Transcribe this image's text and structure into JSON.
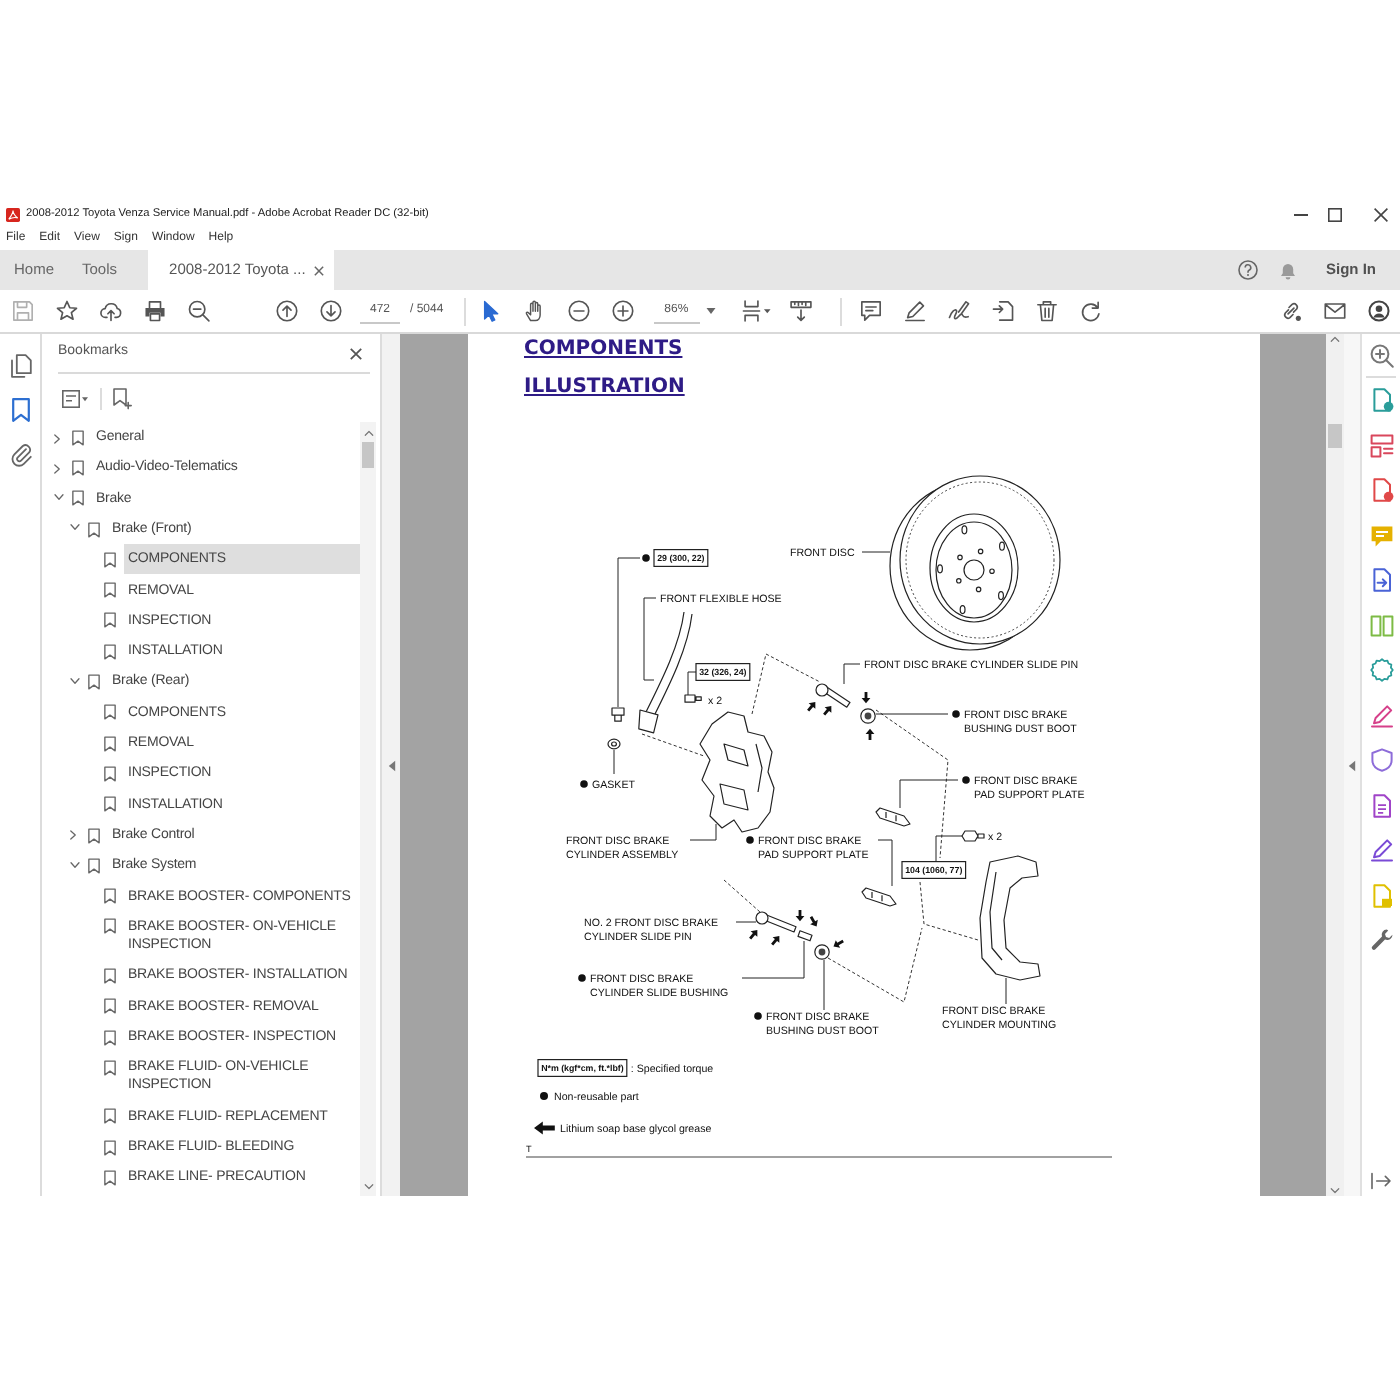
{
  "window": {
    "title": "2008-2012 Toyota Venza Service Manual.pdf - Adobe Acrobat Reader DC (32-bit)"
  },
  "menu": [
    "File",
    "Edit",
    "View",
    "Sign",
    "Window",
    "Help"
  ],
  "tabs": [
    {
      "label": "Home",
      "selected": false,
      "closable": false
    },
    {
      "label": "Tools",
      "selected": false,
      "closable": false
    },
    {
      "label": "2008-2012 Toyota ...",
      "selected": true,
      "closable": true
    }
  ],
  "account": {
    "sign_in": "Sign In"
  },
  "toolbar": {
    "page": "472",
    "page_count": "/ 5044",
    "pointer_tools": [
      {
        "kind": "select",
        "selected": true
      },
      {
        "kind": "hand",
        "selected": false
      }
    ],
    "zoom": "86%"
  },
  "side_panels": [
    {
      "kind": "pages",
      "selected": false
    },
    {
      "kind": "bookmarks",
      "selected": true
    },
    {
      "kind": "attachments",
      "selected": false
    }
  ],
  "bookmarks": {
    "title": "Bookmarks",
    "items": [
      {
        "label": "General",
        "kind": "group",
        "expanded": false,
        "selected": false
      },
      {
        "label": "Audio-Video-Telematics",
        "kind": "group",
        "expanded": false,
        "selected": false
      },
      {
        "label": "Brake",
        "kind": "group",
        "expanded": true,
        "selected": false,
        "children": [
          {
            "label": "Brake (Front)",
            "kind": "group",
            "expanded": true,
            "selected": false,
            "children": [
              {
                "label": "COMPONENTS",
                "kind": "page",
                "selected": true
              },
              {
                "label": "REMOVAL",
                "kind": "page",
                "selected": false
              },
              {
                "label": "INSPECTION",
                "kind": "page",
                "selected": false
              },
              {
                "label": "INSTALLATION",
                "kind": "page",
                "selected": false
              }
            ]
          },
          {
            "label": "Brake (Rear)",
            "kind": "group",
            "expanded": true,
            "selected": false,
            "children": [
              {
                "label": "COMPONENTS",
                "kind": "page",
                "selected": false
              },
              {
                "label": "REMOVAL",
                "kind": "page",
                "selected": false
              },
              {
                "label": "INSPECTION",
                "kind": "page",
                "selected": false
              },
              {
                "label": "INSTALLATION",
                "kind": "page",
                "selected": false
              }
            ]
          },
          {
            "label": "Brake Control",
            "kind": "group",
            "expanded": false,
            "selected": false
          },
          {
            "label": "Brake System",
            "kind": "group",
            "expanded": true,
            "selected": false,
            "children": [
              {
                "label": "BRAKE BOOSTER- COMPONENTS",
                "kind": "page",
                "selected": false
              },
              {
                "label": "BRAKE BOOSTER- ON-VEHICLE INSPECTION",
                "kind": "page",
                "selected": false
              },
              {
                "label": "BRAKE BOOSTER- INSTALLATION",
                "kind": "page",
                "selected": false
              },
              {
                "label": "BRAKE BOOSTER- REMOVAL",
                "kind": "page",
                "selected": false
              },
              {
                "label": "BRAKE BOOSTER- INSPECTION",
                "kind": "page",
                "selected": false
              },
              {
                "label": "BRAKE FLUID- ON-VEHICLE INSPECTION",
                "kind": "page",
                "selected": false
              },
              {
                "label": "BRAKE FLUID- REPLACEMENT",
                "kind": "page",
                "selected": false
              },
              {
                "label": "BRAKE FLUID- BLEEDING",
                "kind": "page",
                "selected": false
              },
              {
                "label": "BRAKE LINE- PRECAUTION",
                "kind": "page",
                "selected": false
              }
            ]
          }
        ]
      }
    ]
  },
  "document": {
    "headings": [
      "COMPONENTS",
      "ILLUSTRATION"
    ],
    "labels": [
      {
        "lines": [
          "FRONT DISC"
        ],
        "non_reusable": false
      },
      {
        "lines": [
          "FRONT FLEXIBLE HOSE"
        ],
        "non_reusable": false
      },
      {
        "lines": [
          "FRONT DISC BRAKE CYLINDER SLIDE PIN"
        ],
        "non_reusable": false
      },
      {
        "lines": [
          "FRONT DISC BRAKE",
          "BUSHING DUST BOOT"
        ],
        "non_reusable": true
      },
      {
        "lines": [
          "GASKET"
        ],
        "non_reusable": true
      },
      {
        "lines": [
          "FRONT DISC BRAKE",
          "PAD SUPPORT PLATE"
        ],
        "non_reusable": true
      },
      {
        "lines": [
          "FRONT DISC BRAKE",
          "CYLINDER ASSEMBLY"
        ],
        "non_reusable": false
      },
      {
        "lines": [
          "FRONT DISC BRAKE",
          "PAD SUPPORT PLATE"
        ],
        "non_reusable": true
      },
      {
        "lines": [
          "NO. 2 FRONT DISC BRAKE",
          "CYLINDER SLIDE PIN"
        ],
        "non_reusable": false
      },
      {
        "lines": [
          "FRONT DISC BRAKE",
          "CYLINDER SLIDE BUSHING"
        ],
        "non_reusable": true
      },
      {
        "lines": [
          "FRONT DISC BRAKE",
          "BUSHING DUST BOOT"
        ],
        "non_reusable": true
      },
      {
        "lines": [
          "FRONT DISC BRAKE",
          "CYLINDER MOUNTING"
        ],
        "non_reusable": false
      }
    ],
    "torques": [
      {
        "value": "29 (300, 22)",
        "non_reusable": true
      },
      {
        "value": "32 (326, 24)",
        "non_reusable": false
      },
      {
        "value": "104 (1060, 77)",
        "non_reusable": false
      }
    ],
    "quantities": [
      "x 2",
      "x 2"
    ],
    "legend": [
      {
        "kind": "torque",
        "symbol": "N*m (kgf*cm, ft.*lbf)",
        "text": ": Specified torque"
      },
      {
        "kind": "non_reusable",
        "text": "Non-reusable part"
      },
      {
        "kind": "grease",
        "text": "Lithium soap base glycol grease"
      }
    ],
    "page_mark": "T"
  }
}
